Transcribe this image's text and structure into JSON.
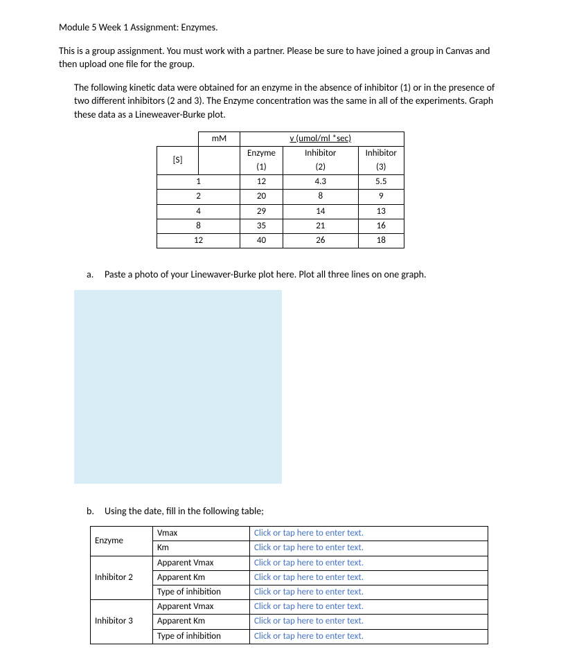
{
  "title": "Module 5 Week 1 Assignment:   Enzymes.",
  "intro": "This is a group assignment.  You must work with a partner. Please be sure to have joined a group in Canvas and then upload one file for the group.",
  "description": "The following kinetic data were obtained for an enzyme in the absence of inhibitor (1) or in the presence of two different inhibitors (2 and 3). The Enzyme concentration was the same in all of the experiments.  Graph these data as a Lineweaver-Burke plot.",
  "kinetic_table": {
    "header_top_left": "mM",
    "header_top_right": "v (umol/ml *sec)",
    "col_s": "[S]",
    "col_enzyme_top": "Enzyme",
    "col_enzyme_bot": "(1)",
    "col_inh2_top": "Inhibitor",
    "col_inh2_bot": "(2)",
    "col_inh3_top": "Inhibitor",
    "col_inh3_bot": "(3)",
    "rows": [
      {
        "s": "1",
        "e": "12",
        "i2": "4.3",
        "i3": "5.5"
      },
      {
        "s": "2",
        "e": "20",
        "i2": "8",
        "i3": "9"
      },
      {
        "s": "4",
        "e": "29",
        "i2": "14",
        "i3": "13"
      },
      {
        "s": "8",
        "e": "35",
        "i2": "21",
        "i3": "16"
      },
      {
        "s": "12",
        "e": "40",
        "i2": "26",
        "i3": "18"
      }
    ]
  },
  "question_a_marker": "a.",
  "question_a_text": "Paste a photo of your Linewaver-Burke plot here.  Plot all three lines on one graph.",
  "question_b_marker": "b.",
  "question_b_text": "Using the date, fill in the following table;",
  "answer_table": {
    "placeholder": "Click or tap here to enter text.",
    "groups": [
      {
        "label": "Enzyme",
        "params": [
          "Vmax",
          "Km"
        ]
      },
      {
        "label": "Inhibitor 2",
        "params": [
          "Apparent Vmax",
          "Apparent Km",
          "Type of inhibition"
        ]
      },
      {
        "label": "Inhibitor 3",
        "params": [
          "Apparent Vmax",
          "Apparent Km",
          "Type of inhibition"
        ]
      }
    ]
  }
}
